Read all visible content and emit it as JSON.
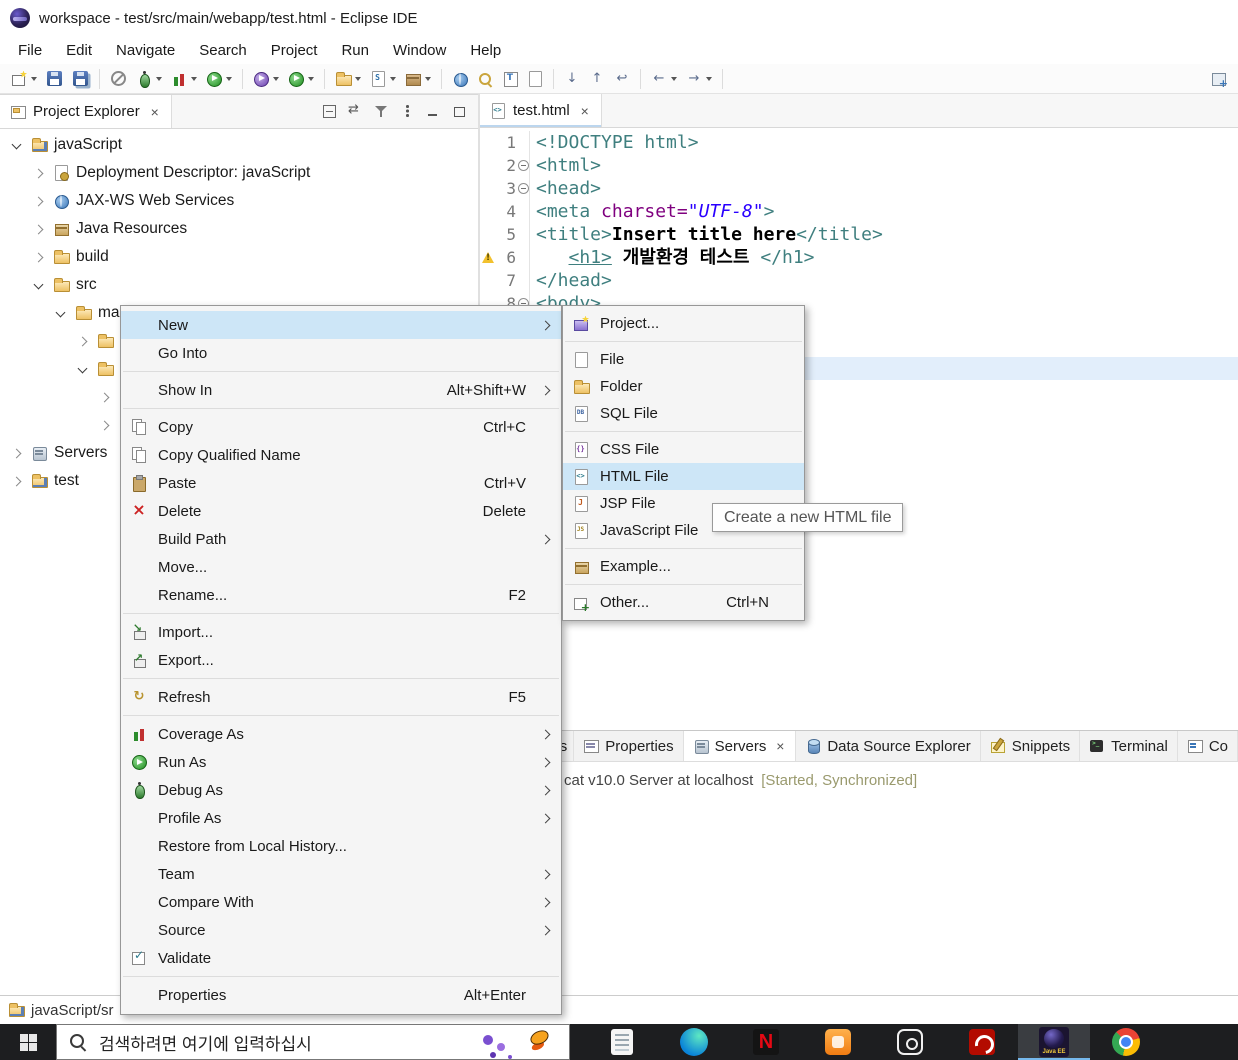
{
  "window": {
    "title": "workspace - test/src/main/webapp/test.html - Eclipse IDE"
  },
  "menubar": {
    "items": [
      "File",
      "Edit",
      "Navigate",
      "Search",
      "Project",
      "Run",
      "Window",
      "Help"
    ]
  },
  "toolbar": {
    "buttons": [
      {
        "name": "new-wizard",
        "drop": true
      },
      {
        "name": "save"
      },
      {
        "name": "save-all"
      },
      "sep",
      {
        "name": "skip-breakpoints"
      },
      {
        "name": "debug",
        "drop": true
      },
      {
        "name": "coverage",
        "drop": true
      },
      {
        "name": "run",
        "drop": true
      },
      "sep",
      {
        "name": "profile",
        "drop": true
      },
      {
        "name": "external-tools",
        "drop": true
      },
      "sep",
      {
        "name": "new-web-project",
        "drop": true
      },
      {
        "name": "new-servlet",
        "drop": true
      },
      {
        "name": "new-package",
        "drop": true
      },
      "sep",
      {
        "name": "open-web-browser"
      },
      {
        "name": "search"
      },
      {
        "name": "open-type"
      },
      {
        "name": "open-resource"
      },
      "sep",
      {
        "name": "next-annotation"
      },
      {
        "name": "prev-annotation"
      },
      {
        "name": "last-edit-location"
      },
      "sep",
      {
        "name": "back",
        "drop": true
      },
      {
        "name": "forward",
        "drop": true
      },
      "sep",
      {
        "name": "open-perspective",
        "right": true
      }
    ]
  },
  "explorer": {
    "tab_label": "Project Explorer",
    "toolbar_icons": [
      "collapse-all",
      "link-with-editor",
      "filter",
      "view-menu",
      "minimize",
      "maximize"
    ],
    "tree": [
      {
        "label": "javaScript",
        "level": 0,
        "state": "expanded",
        "icon": "project"
      },
      {
        "label": "Deployment Descriptor: javaScript",
        "level": 1,
        "state": "collapsed",
        "icon": "descriptor"
      },
      {
        "label": "JAX-WS Web Services",
        "level": 1,
        "state": "collapsed",
        "icon": "webservice"
      },
      {
        "label": "Java Resources",
        "level": 1,
        "state": "collapsed",
        "icon": "java-resources"
      },
      {
        "label": "build",
        "level": 1,
        "state": "collapsed",
        "icon": "folder"
      },
      {
        "label": "src",
        "level": 1,
        "state": "expanded",
        "icon": "folder"
      },
      {
        "label": "ma",
        "level": 2,
        "state": "expanded",
        "icon": "folder"
      },
      {
        "label": "",
        "level": 3,
        "state": "collapsed",
        "icon": "folder"
      },
      {
        "label": "",
        "level": 3,
        "state": "expanded",
        "icon": "folder"
      },
      {
        "label": "",
        "level": 4,
        "state": "collapsed",
        "icon": "none"
      },
      {
        "label": "",
        "level": 4,
        "state": "collapsed",
        "icon": "none"
      },
      {
        "label": "Servers",
        "level": 0,
        "state": "collapsed",
        "icon": "server"
      },
      {
        "label": "test",
        "level": 0,
        "state": "collapsed",
        "icon": "project"
      }
    ]
  },
  "editor": {
    "tab_label": "test.html",
    "lines": [
      {
        "num": "1",
        "parts": [
          {
            "t": "<!DOCTYPE html>",
            "c": "tag"
          }
        ]
      },
      {
        "num": "2",
        "fold": true,
        "parts": [
          {
            "t": "<html>",
            "c": "tag"
          }
        ]
      },
      {
        "num": "3",
        "fold": true,
        "parts": [
          {
            "t": "<head>",
            "c": "tag"
          }
        ]
      },
      {
        "num": "4",
        "parts": [
          {
            "t": "<meta ",
            "c": "tag"
          },
          {
            "t": "charset=",
            "c": "attr"
          },
          {
            "t": "\"UTF-8\"",
            "c": "val"
          },
          {
            "t": ">",
            "c": "tag"
          }
        ]
      },
      {
        "num": "5",
        "parts": [
          {
            "t": "<title>",
            "c": "tag"
          },
          {
            "t": "Insert title here",
            "c": "text"
          },
          {
            "t": "</title>",
            "c": "tag"
          }
        ]
      },
      {
        "num": "6",
        "warn": true,
        "parts": [
          {
            "t": "   ",
            "c": "text"
          },
          {
            "t": "<h1>",
            "c": "taglink"
          },
          {
            "t": " 개발환경 테스트 ",
            "c": "text"
          },
          {
            "t": "</h1>",
            "c": "tag"
          }
        ]
      },
      {
        "num": "7",
        "parts": [
          {
            "t": "</head>",
            "c": "tag"
          }
        ]
      },
      {
        "num": "8",
        "fold": true,
        "parts": [
          {
            "t": "<body>",
            "c": "tag"
          }
        ]
      }
    ]
  },
  "context_menu": {
    "items": [
      {
        "label": "New",
        "submenu": true,
        "selected": true
      },
      {
        "label": "Go Into"
      },
      {
        "sep": true
      },
      {
        "label": "Show In",
        "accel": "Alt+Shift+W",
        "submenu": true
      },
      {
        "sep": true
      },
      {
        "label": "Copy",
        "icon": "copy",
        "accel": "Ctrl+C"
      },
      {
        "label": "Copy Qualified Name",
        "icon": "copy-qualified"
      },
      {
        "label": "Paste",
        "icon": "paste",
        "accel": "Ctrl+V"
      },
      {
        "label": "Delete",
        "icon": "delete",
        "accel": "Delete"
      },
      {
        "label": "Build Path",
        "submenu": true
      },
      {
        "label": "Move..."
      },
      {
        "label": "Rename...",
        "accel": "F2"
      },
      {
        "sep": true
      },
      {
        "label": "Import...",
        "icon": "import"
      },
      {
        "label": "Export...",
        "icon": "export"
      },
      {
        "sep": true
      },
      {
        "label": "Refresh",
        "icon": "refresh",
        "accel": "F5"
      },
      {
        "sep": true
      },
      {
        "label": "Coverage As",
        "icon": "coverage",
        "submenu": true
      },
      {
        "label": "Run As",
        "icon": "run",
        "submenu": true
      },
      {
        "label": "Debug As",
        "icon": "debug",
        "submenu": true
      },
      {
        "label": "Profile As",
        "submenu": true
      },
      {
        "label": "Restore from Local History..."
      },
      {
        "label": "Team",
        "submenu": true
      },
      {
        "label": "Compare With",
        "submenu": true
      },
      {
        "label": "Source",
        "submenu": true
      },
      {
        "label": "Validate",
        "icon": "validate"
      },
      {
        "sep": true
      },
      {
        "label": "Properties",
        "accel": "Alt+Enter"
      }
    ]
  },
  "new_submenu": {
    "items": [
      {
        "label": "Project...",
        "icon": "project-wizard"
      },
      {
        "sep": true
      },
      {
        "label": "File",
        "icon": "file"
      },
      {
        "label": "Folder",
        "icon": "folder"
      },
      {
        "label": "SQL File",
        "icon": "sql-file"
      },
      {
        "sep": true
      },
      {
        "label": "CSS File",
        "icon": "css-file"
      },
      {
        "label": "HTML File",
        "icon": "html-file",
        "selected": true
      },
      {
        "label": "JSP File",
        "icon": "jsp-file"
      },
      {
        "label": "JavaScript File",
        "icon": "js-file"
      },
      {
        "sep": true
      },
      {
        "label": "Example...",
        "icon": "example"
      },
      {
        "sep": true
      },
      {
        "label": "Other...",
        "icon": "other",
        "accel": "Ctrl+N"
      }
    ]
  },
  "tooltip": {
    "text": "Create a new HTML file"
  },
  "bottom_panel": {
    "partial_tab": "s",
    "tabs": [
      {
        "label": "Properties",
        "icon": "properties"
      },
      {
        "label": "Servers",
        "icon": "servers",
        "active": true,
        "closable": true
      },
      {
        "label": "Data Source Explorer",
        "icon": "data-source"
      },
      {
        "label": "Snippets",
        "icon": "snippets"
      },
      {
        "label": "Terminal",
        "icon": "terminal"
      },
      {
        "label": "Co",
        "icon": "console"
      }
    ],
    "server_entry": {
      "text": "cat v10.0 Server at localhost",
      "status": "[Started, Synchronized]"
    }
  },
  "statusbar": {
    "text": "javaScript/sr"
  },
  "taskbar": {
    "search_text": "검색하려면 여기에 입력하십시",
    "apps": [
      {
        "name": "document"
      },
      {
        "name": "edge"
      },
      {
        "name": "netflix"
      },
      {
        "name": "orange-app"
      },
      {
        "name": "outline-app"
      },
      {
        "name": "acrobat"
      },
      {
        "name": "eclipse-ide",
        "active": true
      },
      {
        "name": "chrome"
      }
    ]
  },
  "colors": {
    "selection": "#cde6f7",
    "tag_teal": "#3f7f7f",
    "attr_purple": "#7f007f",
    "value_blue": "#2a00ff",
    "status_olive": "#9a9a6e",
    "taskbar_bg": "#1d1e20",
    "accent_blue": "#76b9ed"
  }
}
